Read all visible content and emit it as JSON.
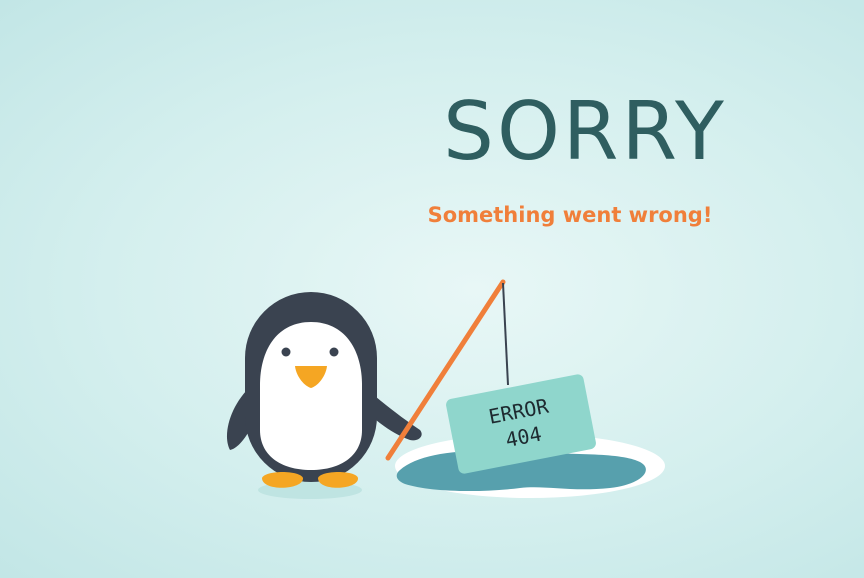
{
  "heading": "SORRY",
  "message": "Something went wrong!",
  "sign": {
    "line1": "ERROR",
    "line2": "404"
  },
  "colors": {
    "background": "#d4efee",
    "heading": "#2f5e60",
    "message": "#f07f3a",
    "penguin_body": "#3a4350",
    "penguin_belly": "#ffffff",
    "beak_feet": "#f5a623",
    "fishing_rod": "#f07f3a",
    "sign": "#8fd6cc",
    "ice": "#ffffff",
    "water": "#57a0ad"
  }
}
